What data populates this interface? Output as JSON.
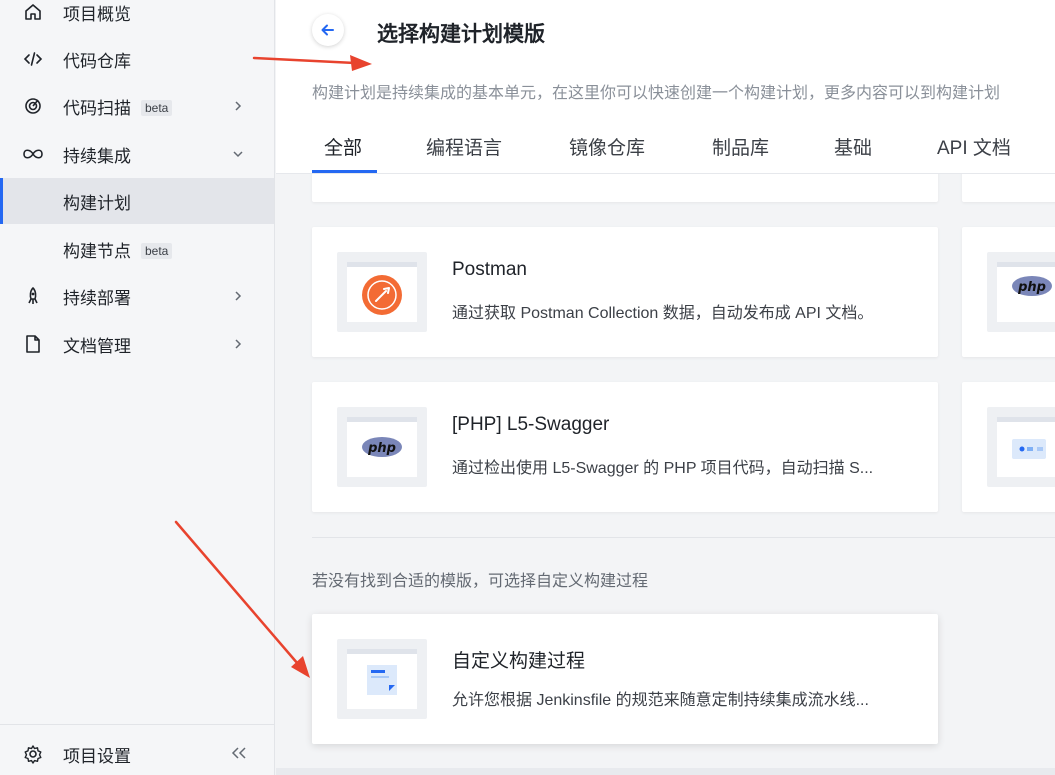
{
  "sidebar": {
    "items": [
      {
        "label": "项目概览",
        "icon": "home-icon"
      },
      {
        "label": "代码仓库",
        "icon": "code-icon"
      },
      {
        "label": "代码扫描",
        "badge": "beta",
        "icon": "scan-icon"
      },
      {
        "label": "持续集成",
        "icon": "infinity-icon"
      },
      {
        "label": "构建计划"
      },
      {
        "label": "构建节点",
        "badge": "beta"
      },
      {
        "label": "持续部署",
        "icon": "rocket-icon"
      },
      {
        "label": "文档管理",
        "icon": "document-icon"
      }
    ],
    "settings_label": "项目设置",
    "active_item": "构建计划"
  },
  "header": {
    "title": "选择构建计划模版",
    "subtitle": "构建计划是持续集成的基本单元，在这里你可以快速创建一个构建计划，更多内容可以到构建计划",
    "tabs": [
      "全部",
      "编程语言",
      "镜像仓库",
      "制品库",
      "基础",
      "API 文档"
    ],
    "active_tab": "全部"
  },
  "templates": [
    {
      "title": "Postman",
      "desc": "通过获取 Postman Collection 数据，自动发布成 API 文档。"
    },
    {
      "title": "[PHP] L5-Swagger",
      "desc": "通过检出使用 L5-Swagger 的 PHP 项目代码，自动扫描 S..."
    }
  ],
  "custom": {
    "hint": "若没有找到合适的模版，可选择自定义构建过程",
    "title": "自定义构建过程",
    "desc": "允许您根据 Jenkinsfile 的规范来随意定制持续集成流水线..."
  },
  "logos": {
    "php": "php"
  },
  "colors": {
    "accent": "#2468f2",
    "postman": "#f36b34",
    "php": "#7a86b8",
    "annotation_arrow": "#e8432e"
  }
}
